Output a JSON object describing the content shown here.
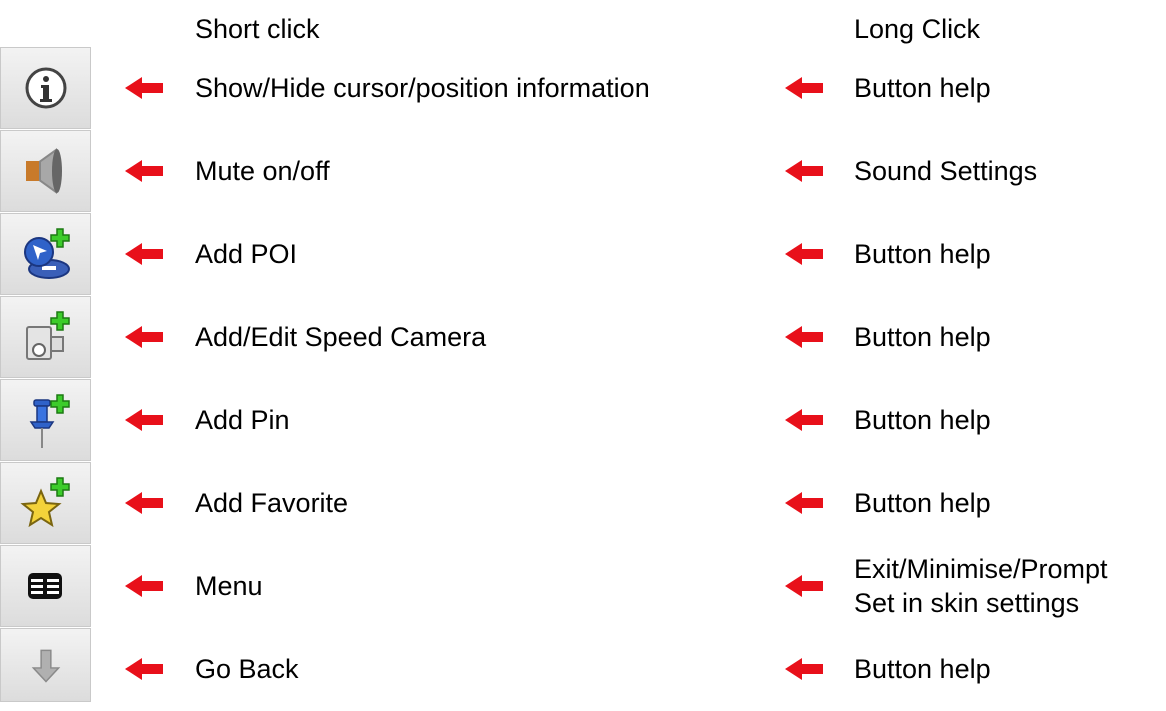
{
  "headers": {
    "short": "Short click",
    "long": "Long Click"
  },
  "rows": [
    {
      "icon": "info-icon",
      "short": "Show/Hide cursor/position information",
      "long": "Button help"
    },
    {
      "icon": "speaker-icon",
      "short": "Mute on/off",
      "long": "Sound Settings"
    },
    {
      "icon": "add-poi-icon",
      "short": "Add POI",
      "long": "Button help"
    },
    {
      "icon": "add-speed-camera-icon",
      "short": "Add/Edit Speed Camera",
      "long": "Button help"
    },
    {
      "icon": "add-pin-icon",
      "short": "Add Pin",
      "long": "Button help"
    },
    {
      "icon": "add-favorite-icon",
      "short": "Add Favorite",
      "long": "Button help"
    },
    {
      "icon": "menu-icon",
      "short": "Menu",
      "long": "Exit/Minimise/Prompt",
      "long2": "Set in skin settings"
    },
    {
      "icon": "go-back-icon",
      "short": "Go Back",
      "long": "Button help"
    }
  ],
  "colors": {
    "arrow": "#e8101a",
    "tile_bg": "#e6e6e6"
  }
}
